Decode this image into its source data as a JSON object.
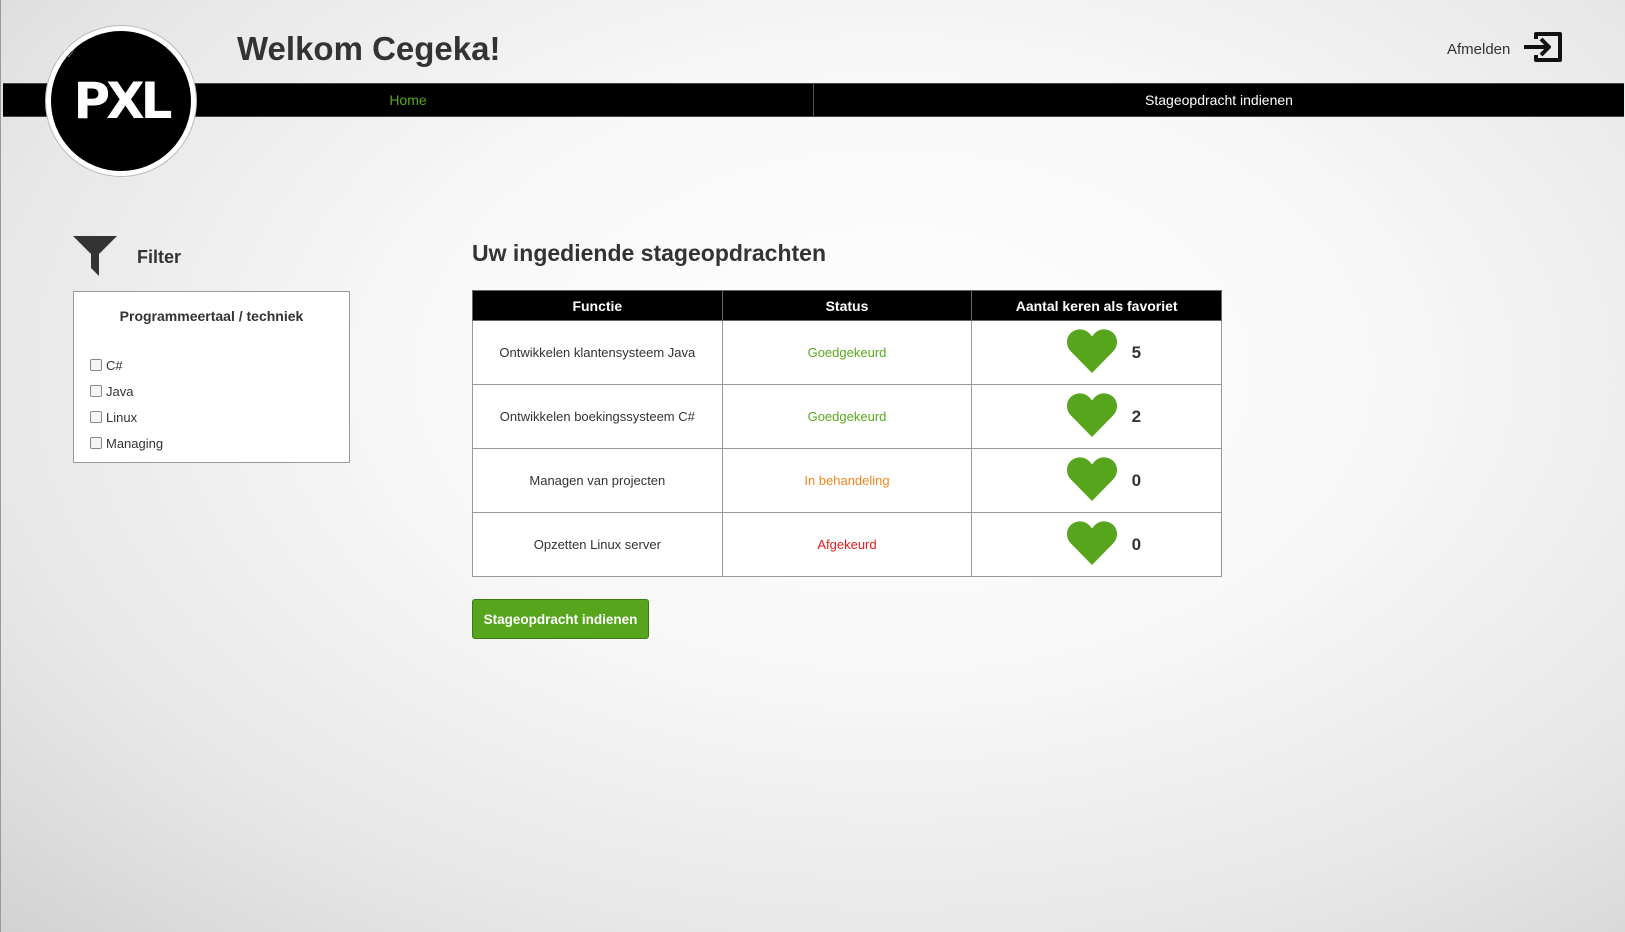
{
  "header": {
    "title": "Welkom Cegeka!",
    "logout_label": "Afmelden",
    "logo_text": "PXL"
  },
  "nav": {
    "items": [
      {
        "label": "Home",
        "active": true
      },
      {
        "label": "Stageopdracht indienen",
        "active": false
      }
    ]
  },
  "filter": {
    "title": "Filter",
    "group_title": "Programmeertaal / techniek",
    "options": [
      "C#",
      "Java",
      "Linux",
      "Managing"
    ]
  },
  "main": {
    "title": "Uw ingediende stageopdrachten",
    "columns": [
      "Functie",
      "Status",
      "Aantal keren als favoriet"
    ],
    "rows": [
      {
        "function": "Ontwikkelen klantensysteem Java",
        "status": "Goedgekeurd",
        "favorites": "5"
      },
      {
        "function": "Ontwikkelen boekingssysteem C#",
        "status": "Goedgekeurd",
        "favorites": "2"
      },
      {
        "function": "Managen van projecten",
        "status": "In behandeling",
        "favorites": "0"
      },
      {
        "function": "Opzetten Linux server",
        "status": "Afgekeurd",
        "favorites": "0"
      }
    ],
    "submit_label": "Stageopdracht indienen"
  },
  "colors": {
    "accent": "#5aa81e",
    "approved": "#5aa81e",
    "pending": "#f0861d",
    "rejected": "#e01b1b",
    "heart": "#57a51c"
  }
}
